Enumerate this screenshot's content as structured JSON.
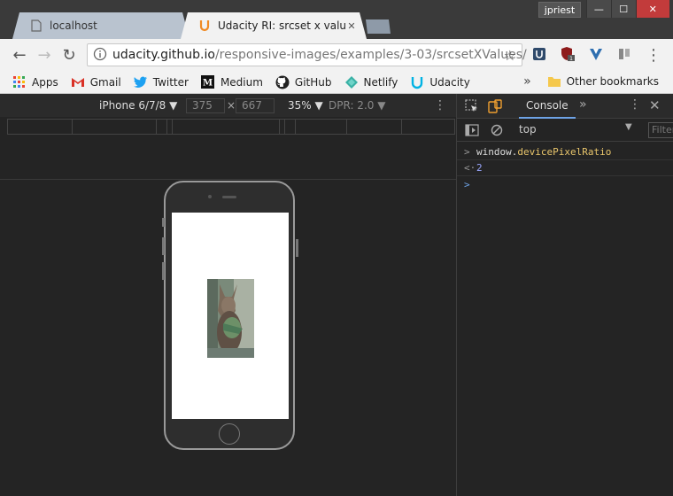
{
  "window": {
    "user": "jpriest",
    "minimize_glyph": "—",
    "maximize_glyph": "☐",
    "close_glyph": "✕"
  },
  "tabs": [
    {
      "title": "localhost",
      "icon": "page-icon",
      "active": false
    },
    {
      "title": "Udacity RI: srcset x values",
      "icon": "udacity-icon",
      "active": true
    }
  ],
  "toolbar": {
    "url_host": "udacity.github.io",
    "url_path": "/responsive-images/examples/3-03/srcsetXValues/",
    "back_glyph": "←",
    "forward_glyph": "→",
    "reload_glyph": "↻",
    "star_glyph": "☆",
    "menu_glyph": "⋮"
  },
  "bookmarks": {
    "items": [
      {
        "label": "Apps",
        "icon": "apps-grid-icon"
      },
      {
        "label": "Gmail",
        "icon": "gmail-icon"
      },
      {
        "label": "Twitter",
        "icon": "twitter-icon"
      },
      {
        "label": "Medium",
        "icon": "medium-icon"
      },
      {
        "label": "GitHub",
        "icon": "github-icon"
      },
      {
        "label": "Netlify",
        "icon": "netlify-icon"
      },
      {
        "label": "Udacity",
        "icon": "udacity-icon"
      }
    ],
    "overflow": "»",
    "other": "Other bookmarks"
  },
  "device_toolbar": {
    "device": "iPhone 6/7/8",
    "width": "375",
    "times": "×",
    "height": "667",
    "zoom": "35%",
    "dpr": "DPR: 2.0",
    "dropdown_glyph": "▼",
    "more_glyph": "⋮"
  },
  "devtools": {
    "tab_console": "Console",
    "more_tabs": "»",
    "kebab": "⋮",
    "close": "✕",
    "context": "top",
    "filter_placeholder": "Filter",
    "lines": [
      {
        "prompt": ">",
        "obj": "window.",
        "prop": "devicePixelRatio"
      },
      {
        "prompt": "<·",
        "value": "2"
      }
    ],
    "input_prompt": ">"
  },
  "colors": {
    "chrome_frame": "#3a3a3a",
    "active_tab": "#f2f2f2",
    "devtools_bg": "#242424",
    "console_accent": "#6ea3e6",
    "property_color": "#e8c56b",
    "number_color": "#9aa7ff"
  }
}
